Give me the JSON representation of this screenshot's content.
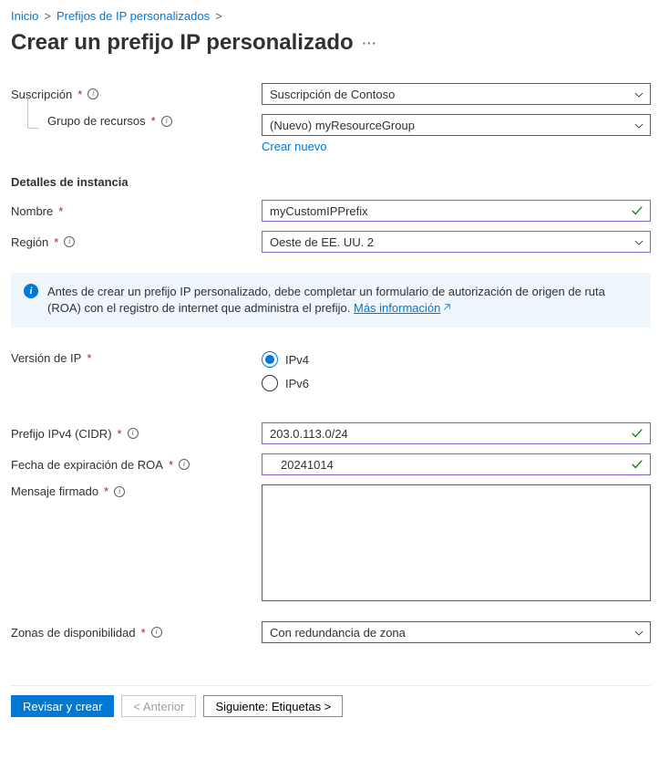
{
  "breadcrumb": {
    "home": "Inicio",
    "list": "Prefijos de IP personalizados"
  },
  "title": "Crear un prefijo IP personalizado",
  "labels": {
    "subscription": "Suscripción",
    "resource_group": "Grupo de recursos",
    "create_new": "Crear nuevo",
    "instance_details": "Detalles de instancia",
    "name": "Nombre",
    "region": "Región",
    "ip_version": "Versión de IP",
    "cidr": "Prefijo IPv4 (CIDR)",
    "roa_exp": "Fecha de expiración de ROA",
    "signed_msg": "Mensaje firmado",
    "az": "Zonas de disponibilidad"
  },
  "values": {
    "subscription": "Suscripción de Contoso",
    "resource_group": "(Nuevo) myResourceGroup",
    "name": "myCustomIPPrefix",
    "region": "Oeste de EE. UU. 2",
    "ipv4": "IPv4",
    "ipv6": "IPv6",
    "cidr": "203.0.113.0/24",
    "roa_exp": "20241014",
    "az": "Con redundancia de zona"
  },
  "info_panel": {
    "text": "Antes de crear un prefijo IP personalizado, debe completar un formulario de autorización de origen de ruta (ROA) con el registro de internet que administra el prefijo. ",
    "link": "Más información"
  },
  "footer": {
    "review": "Revisar y crear",
    "prev": "< Anterior",
    "next": "Siguiente: Etiquetas >"
  }
}
